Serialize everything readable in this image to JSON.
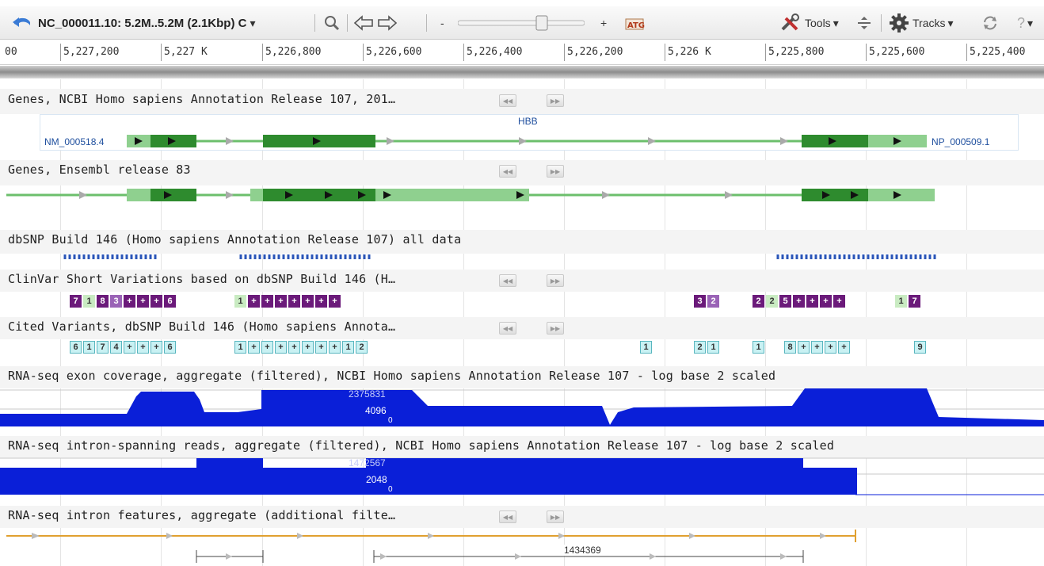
{
  "toolbar": {
    "back_icon": "curved-back-arrow-icon",
    "sequence_title": "NC_000011.10: 5.2M..5.2M (2.1Kbp) C",
    "zoom_icon": "magnifier-icon",
    "pan_left_icon": "left-arrow-icon",
    "pan_right_icon": "right-arrow-icon",
    "zoom_out_label": "-",
    "zoom_in_label": "+",
    "slider_level": 0.68,
    "atg_icon": "atg-sequence-icon",
    "tools_label": "Tools",
    "tracks_label": "Tracks",
    "help_label": "?"
  },
  "ruler": {
    "ticks": [
      "00",
      "5,227,200",
      "5,227 K",
      "5,226,800",
      "5,226,600",
      "5,226,400",
      "5,226,200",
      "5,226 K",
      "5,225,800",
      "5,225,600",
      "5,225,400"
    ]
  },
  "tracks": {
    "genes_ncbi": {
      "title": "Genes, NCBI Homo sapiens Annotation Release 107, 201…",
      "gene_name": "HBB",
      "transcript_label": "NM_000518.4",
      "protein_label": "NP_000509.1"
    },
    "genes_ensembl": {
      "title": "Genes, Ensembl release 83"
    },
    "dbsnp": {
      "title": "dbSNP Build 146 (Homo sapiens Annotation Release 107) all data"
    },
    "clinvar": {
      "title": "ClinVar Short Variations based on dbSNP Build 146 (H…",
      "groups": [
        [
          "7",
          "1",
          "8",
          "3",
          "+",
          "+",
          "+",
          "6"
        ],
        [
          "1",
          "+",
          "+",
          "+",
          "+",
          "+",
          "+",
          "+"
        ],
        [
          "3",
          "2"
        ],
        [
          "2",
          "2",
          "5",
          "+",
          "+",
          "+",
          "+"
        ],
        [
          "1",
          "7"
        ]
      ]
    },
    "cited": {
      "title": "Cited Variants, dbSNP Build 146 (Homo sapiens Annota…",
      "groups": [
        [
          "6",
          "1",
          "7",
          "4",
          "+",
          "+",
          "+",
          "6"
        ],
        [
          "1",
          "+",
          "+",
          "+",
          "+",
          "+",
          "+",
          "+",
          "1",
          "2"
        ],
        [
          "1"
        ],
        [
          "2",
          "1"
        ],
        [
          "1"
        ],
        [
          "8",
          "+",
          "+",
          "+",
          "+"
        ],
        [
          "9"
        ]
      ]
    },
    "rnaseq_exon": {
      "title": "RNA-seq exon coverage, aggregate (filtered), NCBI Homo sapiens Annotation Release 107 - log base 2 scaled",
      "scale_top": "2375831",
      "scale_mid": "4096",
      "scale_zero": "0"
    },
    "rnaseq_intron_reads": {
      "title": "RNA-seq intron-spanning reads, aggregate (filtered), NCBI Homo sapiens Annotation Release 107 - log base 2 scaled",
      "scale_top": "1472567",
      "scale_mid": "2048",
      "scale_zero": "0"
    },
    "rnaseq_intron_features": {
      "title": "RNA-seq intron features, aggregate (additional filte…",
      "feature_label": "1434369"
    }
  },
  "colors": {
    "exon_dark": "#2e8b2e",
    "exon_light": "#8fd08f",
    "intron_line": "#6cbf6c",
    "coverage_blue": "#0a1fd8",
    "intron_orange": "#e0a030",
    "clinvar_purple": "#6b1a7a",
    "cited_cyan": "#c9f1f3"
  }
}
